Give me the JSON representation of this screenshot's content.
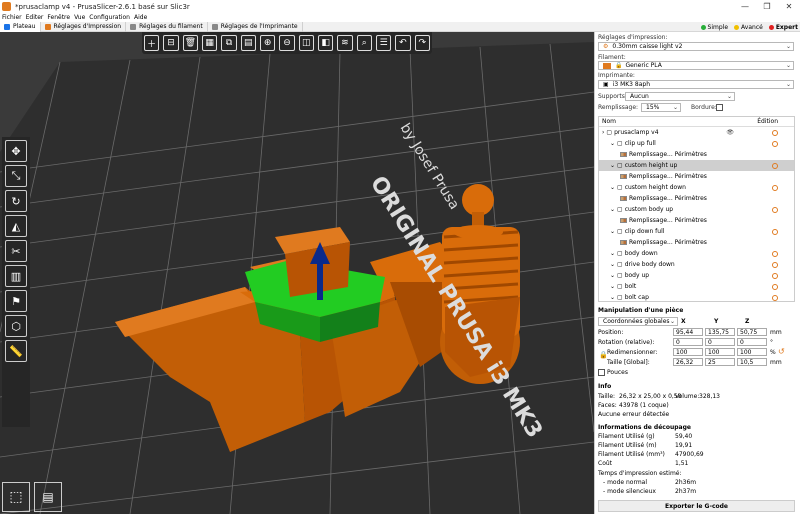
{
  "window": {
    "title": "*prusaclamp v4 - PrusaSlicer-2.6.1 basé sur Slic3r",
    "minimize": "—",
    "maximize": "❐",
    "close": "✕"
  },
  "menu": [
    "Fichier",
    "Editer",
    "Fenêtre",
    "Vue",
    "Configuration",
    "Aide"
  ],
  "tabs": [
    {
      "label": "Plateau",
      "color": "#1a73e8"
    },
    {
      "label": "Réglages d'Impression",
      "color": "#e07a1f"
    },
    {
      "label": "Réglages du filament",
      "color": "#888888"
    },
    {
      "label": "Réglages de l'Imprimante",
      "color": "#888888"
    }
  ],
  "modes": [
    {
      "label": "Simple",
      "color": "#27ae38"
    },
    {
      "label": "Avancé",
      "color": "#f0c000"
    },
    {
      "label": "Expert",
      "color": "#e02020"
    }
  ],
  "viewport": {
    "bed_text_1": "ORIGINAL PRUSA i3 MK3",
    "bed_text_2": "by Josef Prusa",
    "arrow_color": "#0a2a8a",
    "selected_color": "#22cc22",
    "object_color": "#d96c0a"
  },
  "toolbar": {
    "icons": [
      "add-icon",
      "delete-icon",
      "delete-all-icon",
      "arrange-icon",
      "copy-icon",
      "paste-icon",
      "add-instance-icon",
      "remove-instance-icon",
      "split-objects-icon",
      "split-parts-icon",
      "layers-icon",
      "search-icon",
      "variable-layer-height-icon",
      "undo-icon",
      "redo-icon"
    ]
  },
  "right_panel": {
    "print_settings_label": "Réglages d'impression:",
    "print_settings_value": "0.30mm caisse light v2",
    "filament_label": "Filament:",
    "filament_value": "Generic PLA",
    "printer_label": "Imprimante:",
    "printer_value": "i3 MK3 8aph",
    "supports_label": "Supports:",
    "supports_value": "Aucun",
    "infill_label": "Remplissage:",
    "infill_value": "15%",
    "brim_label": "Bordure:",
    "tree_header_name": "Nom",
    "tree_header_edit": "Édition",
    "tree": [
      {
        "label": "prusaclamp v4",
        "indent": 0,
        "eye": true
      },
      {
        "label": "clip up full",
        "indent": 1
      },
      {
        "label": "Remplissage... Périmètres",
        "indent": 2,
        "fill": true
      },
      {
        "label": "custom height up",
        "indent": 1,
        "selected": true
      },
      {
        "label": "Remplissage... Périmètres",
        "indent": 2,
        "fill": true
      },
      {
        "label": "custom height down",
        "indent": 1
      },
      {
        "label": "Remplissage... Périmètres",
        "indent": 2,
        "fill": true
      },
      {
        "label": "custom body up",
        "indent": 1
      },
      {
        "label": "Remplissage... Périmètres",
        "indent": 2,
        "fill": true
      },
      {
        "label": "clip down full",
        "indent": 1
      },
      {
        "label": "Remplissage... Périmètres",
        "indent": 2,
        "fill": true
      },
      {
        "label": "body down",
        "indent": 1
      },
      {
        "label": "drive body down",
        "indent": 1
      },
      {
        "label": "body up",
        "indent": 1
      },
      {
        "label": "bolt",
        "indent": 1
      },
      {
        "label": "bolt cap",
        "indent": 1
      }
    ],
    "manipulation": {
      "title": "Manipulation d'une pièce",
      "coords": "Coordonnées globales",
      "x": "X",
      "y": "Y",
      "z": "Z",
      "position_label": "Position:",
      "position": [
        "95,44",
        "135,75",
        "50,75"
      ],
      "position_unit": "mm",
      "rotation_label": "Rotation (relative):",
      "rotation": [
        "0",
        "0",
        "0"
      ],
      "rotation_unit": "°",
      "resize_label": "Redimensionner:",
      "resize": [
        "100",
        "100",
        "100"
      ],
      "resize_unit": "%",
      "size_label": "Taille [Global]:",
      "size": [
        "26,32",
        "25",
        "10,5"
      ],
      "size_unit": "mm",
      "inches_label": "Pouces"
    },
    "info": {
      "title": "Info",
      "size_label": "Taille:",
      "size_value": "26,32 x 25,00 x 0,50",
      "volume_label": "Volume:",
      "volume_value": "328,13",
      "faces_label": "Faces:",
      "faces_value": "43978 (1 coque)",
      "errors": "Aucune erreur détectée"
    },
    "slicing": {
      "title": "Informations de découpage",
      "rows": [
        {
          "label": "Filament Utilisé (g)",
          "value": "59,40"
        },
        {
          "label": "Filament Utilisé (m)",
          "value": "19,91"
        },
        {
          "label": "Filament Utilisé (mm³)",
          "value": "47900,69"
        },
        {
          "label": "Coût",
          "value": "1,51"
        }
      ],
      "time_label": "Temps d'impression estimé:",
      "normal_label": "- mode normal",
      "normal_value": "2h36m",
      "silent_label": "- mode silencieux",
      "silent_value": "2h37m"
    },
    "export_label": "Exporter le G-code"
  }
}
